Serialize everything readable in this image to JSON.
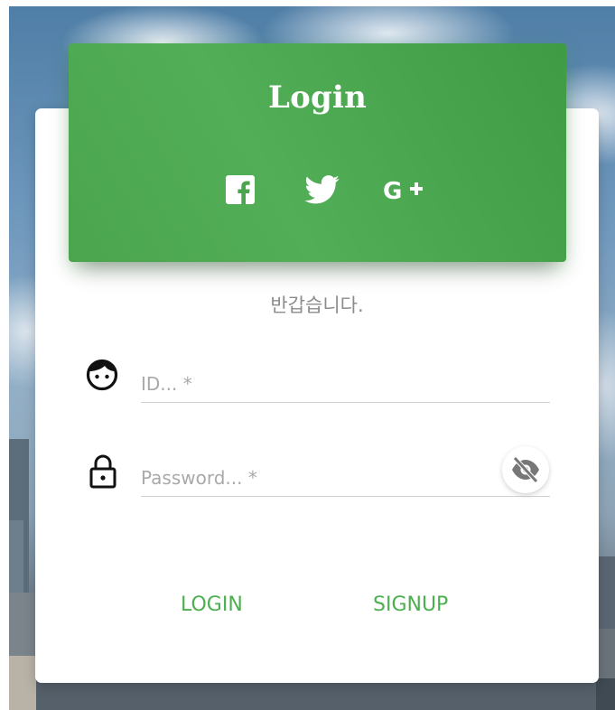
{
  "header": {
    "title": "Login",
    "social": [
      {
        "name": "facebook-icon"
      },
      {
        "name": "twitter-icon"
      },
      {
        "name": "google-plus-icon"
      }
    ]
  },
  "subtitle": "반갑습니다.",
  "form": {
    "id_placeholder": "ID... *",
    "id_value": "",
    "password_placeholder": "Password... *",
    "password_value": ""
  },
  "actions": {
    "login_label": "LOGIN",
    "signup_label": "SIGNUP"
  },
  "colors": {
    "accent": "#4caf50",
    "header": "#4ba54f"
  }
}
